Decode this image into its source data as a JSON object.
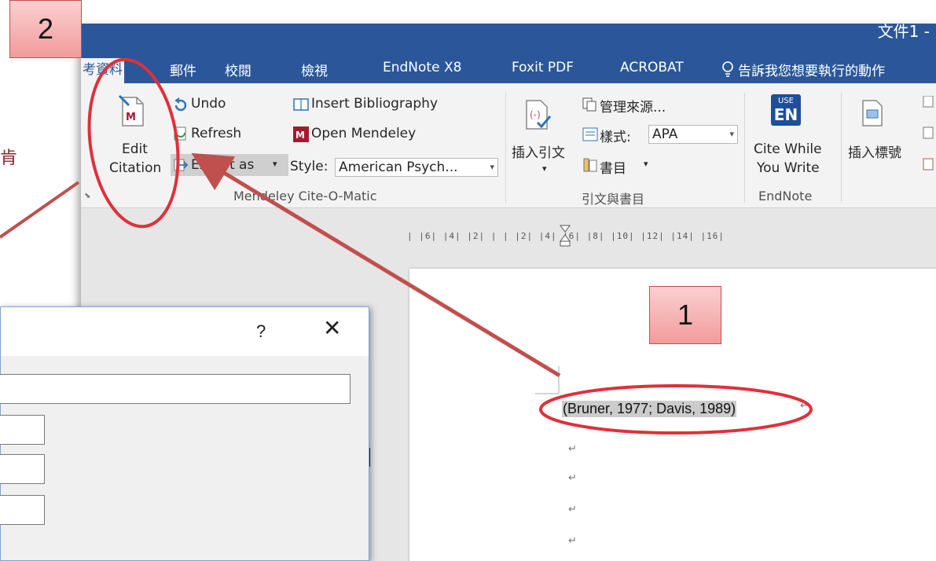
{
  "background": {
    "stray_char": "肯"
  },
  "window": {
    "title": "文件1 -"
  },
  "tabs": [
    {
      "label": "考資料",
      "active": true
    },
    {
      "label": "郵件"
    },
    {
      "label": "校閱"
    },
    {
      "label": "檢視"
    },
    {
      "label": "EndNote X8"
    },
    {
      "label": "Foxit PDF"
    },
    {
      "label": "ACROBAT"
    },
    {
      "label": "告訴我您想要執行的動作"
    }
  ],
  "ribbon": {
    "mendeley": {
      "edit_citation_line1": "Edit",
      "edit_citation_line2": "Citation",
      "undo": "Undo",
      "refresh": "Refresh",
      "export_as": "Export as",
      "insert_bibliography": "Insert Bibliography",
      "open_mendeley": "Open Mendeley",
      "style_label": "Style:",
      "style_value": "American Psych...",
      "group_label": "Mendeley Cite-O-Matic"
    },
    "citations": {
      "insert_citation": "插入引文",
      "manage_sources": "管理來源...",
      "style_label": "樣式:",
      "style_value": "APA",
      "bibliography": "書目",
      "group_label": "引文與書目"
    },
    "endnote": {
      "use_en": "USE",
      "en": "EN",
      "cite_line1": "Cite While",
      "cite_line2": "You Write",
      "group_label": "EndNote"
    },
    "captions": {
      "insert_caption": "插入標號"
    }
  },
  "ruler": {
    "marks": "| |6| |4| |2| |  | |2| |4| |6| |8| |10| |12| |14| |16|"
  },
  "document": {
    "citation_text": "(Bruner, 1977; Davis, 1989)",
    "paragraph_mark": "↵"
  },
  "dialog": {
    "help": "?",
    "close": "✕"
  },
  "callouts": {
    "one": "1",
    "two": "2"
  },
  "colors": {
    "word_blue": "#2b579a",
    "annotation_red": "#c0504d",
    "callout_fill": "#f5b3b3"
  }
}
